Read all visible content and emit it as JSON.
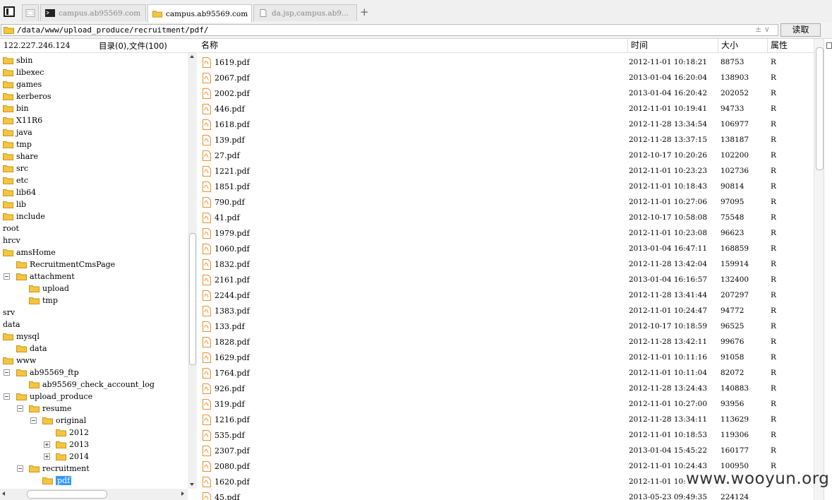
{
  "tabs": [
    {
      "label": ""
    },
    {
      "label": ""
    },
    {
      "label": "campus.ab95569.com"
    },
    {
      "label": "campus.ab95569.com"
    },
    {
      "label": "da.jsp,campus.ab9..."
    }
  ],
  "new_tab": "+",
  "address": {
    "path": "/data/www/upload_produce/recruitment/pdf/",
    "read_button": "读取",
    "dropdown_glyphs": "± ∨"
  },
  "left_panel": {
    "ip": "122.227.246.124",
    "summary": "目录(0),文件(100)"
  },
  "tree": [
    {
      "label": "sbin",
      "folder": true
    },
    {
      "label": "libexec",
      "folder": true
    },
    {
      "label": "games",
      "folder": true
    },
    {
      "label": "kerberos",
      "folder": true
    },
    {
      "label": "bin",
      "folder": true
    },
    {
      "label": "X11R6",
      "folder": true
    },
    {
      "label": "java",
      "folder": true
    },
    {
      "label": "tmp",
      "folder": true
    },
    {
      "label": "share",
      "folder": true
    },
    {
      "label": "src",
      "folder": true
    },
    {
      "label": "etc",
      "folder": true
    },
    {
      "label": "lib64",
      "folder": true
    },
    {
      "label": "lib",
      "folder": true
    },
    {
      "label": "include",
      "folder": true
    },
    {
      "label": "root",
      "folder": false
    },
    {
      "label": "hrcv",
      "folder": false
    },
    {
      "label": "amsHome",
      "folder": true
    },
    {
      "label": "RecruitmentCmsPage",
      "folder": true
    },
    {
      "label": "attachment",
      "folder": true
    },
    {
      "label": "upload",
      "folder": true
    },
    {
      "label": "tmp",
      "folder": true
    },
    {
      "label": "srv",
      "folder": false
    },
    {
      "label": "data",
      "folder": false
    },
    {
      "label": "mysql",
      "folder": true
    },
    {
      "label": "data",
      "folder": true
    },
    {
      "label": "www",
      "folder": true
    },
    {
      "label": "ab95569_ftp",
      "folder": true
    },
    {
      "label": "ab95569_check_account_log",
      "folder": true
    },
    {
      "label": "upload_produce",
      "folder": true
    },
    {
      "label": "resume",
      "folder": true
    },
    {
      "label": "original",
      "folder": true
    },
    {
      "label": "2012",
      "folder": true
    },
    {
      "label": "2013",
      "folder": true
    },
    {
      "label": "2014",
      "folder": true
    },
    {
      "label": "recruitment",
      "folder": true
    },
    {
      "label": "pdf",
      "folder": true
    }
  ],
  "columns": {
    "name": "名称",
    "time": "时间",
    "size": "大小",
    "attr": "属性"
  },
  "files": [
    {
      "name": "1619.pdf",
      "time": "2012-11-01 10:18:21",
      "size": "88753",
      "attr": "R"
    },
    {
      "name": "2067.pdf",
      "time": "2013-01-04 16:20:04",
      "size": "138903",
      "attr": "R"
    },
    {
      "name": "2002.pdf",
      "time": "2013-01-04 16:20:42",
      "size": "202052",
      "attr": "R"
    },
    {
      "name": "446.pdf",
      "time": "2012-11-01 10:19:41",
      "size": "94733",
      "attr": "R"
    },
    {
      "name": "1618.pdf",
      "time": "2012-11-28 13:34:54",
      "size": "106977",
      "attr": "R"
    },
    {
      "name": "139.pdf",
      "time": "2012-11-28 13:37:15",
      "size": "138187",
      "attr": "R"
    },
    {
      "name": "27.pdf",
      "time": "2012-10-17 10:20:26",
      "size": "102200",
      "attr": "R"
    },
    {
      "name": "1221.pdf",
      "time": "2012-11-01 10:23:23",
      "size": "102736",
      "attr": "R"
    },
    {
      "name": "1851.pdf",
      "time": "2012-11-01 10:18:43",
      "size": "90814",
      "attr": "R"
    },
    {
      "name": "790.pdf",
      "time": "2012-11-01 10:27:06",
      "size": "97095",
      "attr": "R"
    },
    {
      "name": "41.pdf",
      "time": "2012-10-17 10:58:08",
      "size": "75548",
      "attr": "R"
    },
    {
      "name": "1979.pdf",
      "time": "2012-11-01 10:23:08",
      "size": "96623",
      "attr": "R"
    },
    {
      "name": "1060.pdf",
      "time": "2013-01-04 16:47:11",
      "size": "168859",
      "attr": "R"
    },
    {
      "name": "1832.pdf",
      "time": "2012-11-28 13:42:04",
      "size": "159914",
      "attr": "R"
    },
    {
      "name": "2161.pdf",
      "time": "2013-01-04 16:16:57",
      "size": "132400",
      "attr": "R"
    },
    {
      "name": "2244.pdf",
      "time": "2012-11-28 13:41:44",
      "size": "207297",
      "attr": "R"
    },
    {
      "name": "1383.pdf",
      "time": "2012-11-01 10:24:47",
      "size": "94772",
      "attr": "R"
    },
    {
      "name": "133.pdf",
      "time": "2012-10-17 10:18:59",
      "size": "96525",
      "attr": "R"
    },
    {
      "name": "1828.pdf",
      "time": "2012-11-28 13:42:11",
      "size": "99676",
      "attr": "R"
    },
    {
      "name": "1629.pdf",
      "time": "2012-11-01 10:11:16",
      "size": "91058",
      "attr": "R"
    },
    {
      "name": "1764.pdf",
      "time": "2012-11-01 10:11:04",
      "size": "82072",
      "attr": "R"
    },
    {
      "name": "926.pdf",
      "time": "2012-11-28 13:24:43",
      "size": "140883",
      "attr": "R"
    },
    {
      "name": "319.pdf",
      "time": "2012-11-01 10:27:00",
      "size": "93956",
      "attr": "R"
    },
    {
      "name": "1216.pdf",
      "time": "2012-11-28 13:34:11",
      "size": "113629",
      "attr": "R"
    },
    {
      "name": "535.pdf",
      "time": "2012-11-01 10:18:53",
      "size": "119306",
      "attr": "R"
    },
    {
      "name": "2307.pdf",
      "time": "2013-01-04 15:45:22",
      "size": "160177",
      "attr": "R"
    },
    {
      "name": "2080.pdf",
      "time": "2012-11-01 10:24:43",
      "size": "100950",
      "attr": "R"
    },
    {
      "name": "1620.pdf",
      "time": "2012-11-01 10:",
      "size": "",
      "attr": ""
    },
    {
      "name": "45.pdf",
      "time": "2013-05-23 09:49:35",
      "size": "224124",
      "attr": ""
    }
  ],
  "watermark": "www.wooyun.org",
  "colors": {
    "folder": "#f5c542",
    "folder_border": "#c9961a",
    "selection": "#3399ff",
    "pdf_icon": "#e8912c"
  }
}
